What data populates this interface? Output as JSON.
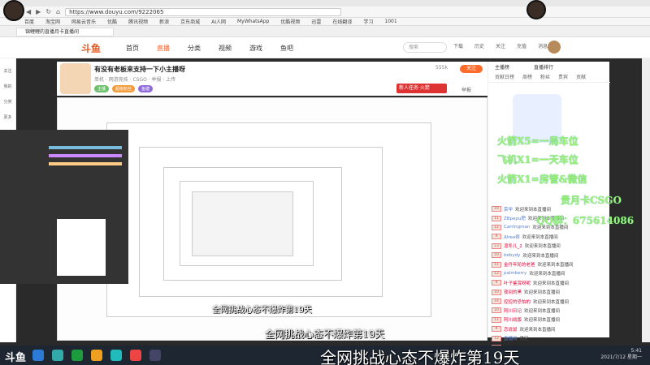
{
  "browser": {
    "url": "https://www.douyu.com/9222065",
    "bookmarks": [
      "百度",
      "淘宝网",
      "网易云音乐",
      "优酷",
      "腾讯视频",
      "新浪",
      "京东商城",
      "AI人网",
      "MyWhatsApp",
      "优酷视频",
      "迅雷",
      "在线翻译",
      "学习",
      "1001"
    ],
    "tab_title": "锦鲤鲤的直播月卡直播间"
  },
  "douyu": {
    "logo": "斗鱼",
    "nav": [
      {
        "label": "首页",
        "active": false
      },
      {
        "label": "直播",
        "active": true
      },
      {
        "label": "分类",
        "active": false
      },
      {
        "label": "视频",
        "active": false
      },
      {
        "label": "游戏",
        "active": false
      },
      {
        "label": "鱼吧",
        "active": false
      }
    ],
    "search_placeholder": "搜索",
    "header_icons": [
      "下载",
      "历史",
      "关注",
      "充值",
      "消息"
    ]
  },
  "sidebar": {
    "items": [
      "关注",
      "我的",
      "分类",
      "更多"
    ]
  },
  "room": {
    "title": "有没有老板来支持一下小主播呀",
    "meta": "单机 · 网游竞技 · CSGO · 举报 · 上传",
    "badges": [
      {
        "label": "主播",
        "color": "#6cc06c"
      },
      {
        "label": "超级粉丝",
        "color": "#f39a3b"
      },
      {
        "label": "鱼塘",
        "color": "#8f6cd9"
      }
    ],
    "fans": "555k",
    "follow_label": "关注",
    "task_label": "新人任务·火箭",
    "report_label": "举报"
  },
  "right_panel": {
    "header": [
      "主播榜",
      "直播排行"
    ],
    "tabs": [
      "贡献日榜",
      "周榜",
      "粉丝",
      "贵宾",
      "贡献"
    ]
  },
  "chat": [
    {
      "lv": "10",
      "user": "荣甲",
      "text": "欢迎来到本直播间",
      "red": false
    },
    {
      "lv": "11",
      "user": "ZBpepu肥",
      "text": "欢迎来到本直播间",
      "red": false
    },
    {
      "lv": "12",
      "user": "Carringman",
      "text": "欢迎来到本直播间",
      "red": false
    },
    {
      "lv": "9",
      "user": "Alree嫁",
      "text": "欢迎来到本直播间",
      "red": false
    },
    {
      "lv": "13",
      "user": "凛冬儿_2",
      "text": "欢迎来到本直播间",
      "red": true
    },
    {
      "lv": "10",
      "user": "bebydy",
      "text": "欢迎来到本直播间",
      "red": false
    },
    {
      "lv": "11",
      "user": "金丹年轮的老爸",
      "text": "欢迎来到本直播间",
      "red": true
    },
    {
      "lv": "12",
      "user": "palmberry",
      "text": "欢迎来到本直播间",
      "red": false
    },
    {
      "lv": "9",
      "user": "叶子鉴赏呀呢",
      "text": "欢迎来到本直播间",
      "red": true
    },
    {
      "lv": "10",
      "user": "夜间的黑",
      "text": "欢迎来到本直播间",
      "red": true
    },
    {
      "lv": "14",
      "user": "控控的恐怕的",
      "text": "欢迎来到本直播间",
      "red": true
    },
    {
      "lv": "10",
      "user": "阿川日记",
      "text": "欢迎来到本直播间",
      "red": true
    },
    {
      "lv": "11",
      "user": "阿川战版",
      "text": "欢迎来到本直播间",
      "red": true
    },
    {
      "lv": "9",
      "user": "恋说鼠",
      "text": "欢迎来到本直播间",
      "red": true
    },
    {
      "lv": "12",
      "user": "直播间",
      "text": "确定",
      "red": false
    },
    {
      "lv": "13",
      "user": "两为跟翻上王者",
      "text": "欢迎来到本直播间",
      "red": true
    },
    {
      "lv": "10",
      "user": "温柔爸坐天下第一",
      "text": "欢迎来到本直播间",
      "red": true
    },
    {
      "lv": "11",
      "user": "palmberry",
      "text": "欢迎来到本直播间",
      "red": false
    },
    {
      "lv": "9",
      "user": "宏川的空",
      "text": "欢迎来到本直播间",
      "red": true
    }
  ],
  "overlay": {
    "lines": [
      "火箭X5=一局车位",
      "飞机X1=一天车位",
      "火箭X1=房管&微信",
      "贵月卡CSGO",
      "QQ群：675614086"
    ]
  },
  "captions": {
    "small": "全网挑战心态不爆炸第19天",
    "medium": "全网挑战心态不爆炸第19天",
    "large": "全网挑战心态不爆炸第19天"
  },
  "taskbar": {
    "time": "5:41",
    "date": "2021/7/12 星期一"
  },
  "colors": {
    "accent": "#ff5d23",
    "overlay_green": "#9cf07a",
    "taskbar": "#1e2632"
  }
}
